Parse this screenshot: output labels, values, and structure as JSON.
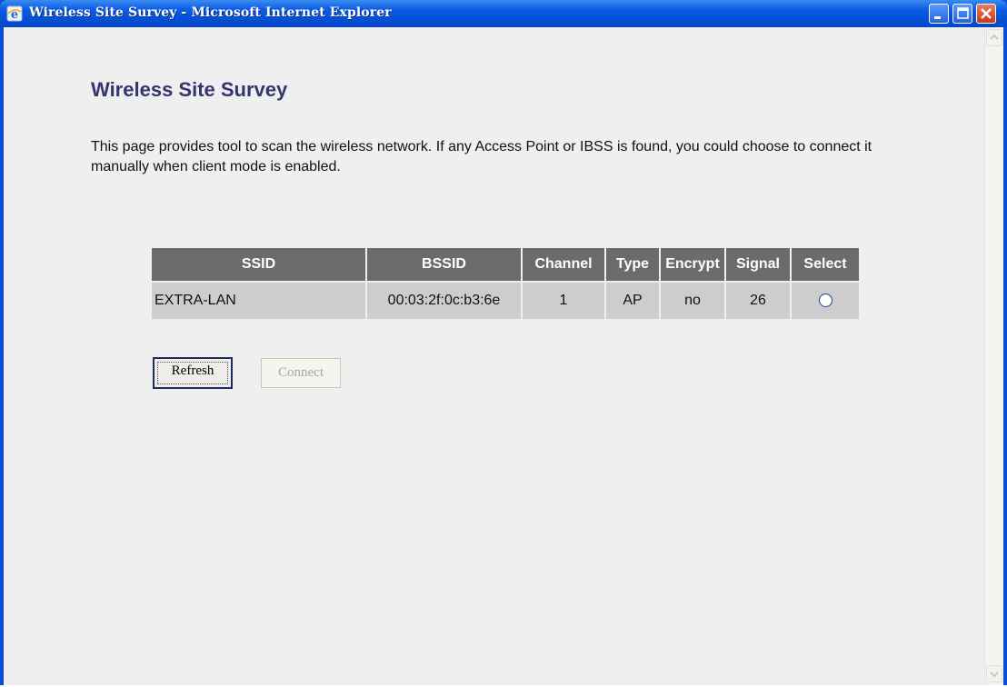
{
  "window": {
    "title": "Wireless Site Survey - Microsoft Internet Explorer"
  },
  "page": {
    "heading": "Wireless Site Survey",
    "description": "This page provides tool to scan the wireless network. If any Access Point or IBSS is found, you could choose to connect it manually when client mode is enabled."
  },
  "table": {
    "headers": [
      "SSID",
      "BSSID",
      "Channel",
      "Type",
      "Encrypt",
      "Signal",
      "Select"
    ],
    "rows": [
      {
        "ssid": "EXTRA-LAN",
        "bssid": "00:03:2f:0c:b3:6e",
        "channel": "1",
        "type": "AP",
        "encrypt": "no",
        "signal": "26",
        "selected": false
      }
    ]
  },
  "buttons": {
    "refresh": "Refresh",
    "connect": "Connect"
  },
  "colors": {
    "titlebar": "#0b5ce5",
    "heading": "#35366f",
    "table_header": "#6b6b6b",
    "table_cell": "#cdcdcd"
  }
}
